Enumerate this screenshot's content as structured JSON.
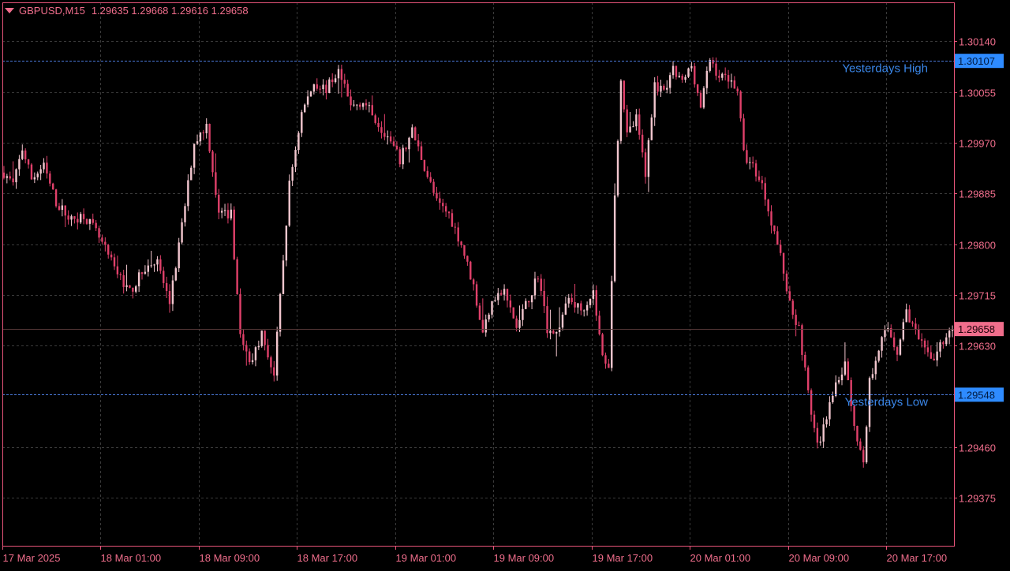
{
  "header": {
    "symbol": "GBPUSD,M15",
    "ohlc": "1.29635 1.29668 1.29616 1.29658"
  },
  "colors": {
    "background": "#000000",
    "frame": "#E8557A",
    "grid": "#3A3A3A",
    "bull": "#F2C6CE",
    "bear": "#E0406A",
    "level_line": "#4A78D8",
    "level_label": "#2E8BFF",
    "level_text": "#3A86E8",
    "price_label": "#F06E8C",
    "axis_text": "#F06E8C"
  },
  "levels": {
    "high": {
      "label": "Yesterdays High",
      "price": 1.30107,
      "price_text": "1.30107"
    },
    "low": {
      "label": "Yesterdays Low",
      "price": 1.29548,
      "price_text": "1.29548"
    },
    "current": {
      "price": 1.29658,
      "price_text": "1.29658"
    }
  },
  "chart_data": {
    "type": "candlestick",
    "title": "GBPUSD,M15",
    "ylim": [
      1.29295,
      1.30205
    ],
    "y_ticks": [
      "1.30140",
      "1.30055",
      "1.29970",
      "1.29885",
      "1.29800",
      "1.29715",
      "1.29630",
      "1.29460",
      "1.29375"
    ],
    "x_ticks": [
      "17 Mar 2025",
      "18 Mar 01:00",
      "18 Mar 09:00",
      "18 Mar 17:00",
      "19 Mar 01:00",
      "19 Mar 09:00",
      "19 Mar 17:00",
      "20 Mar 01:00",
      "20 Mar 09:00",
      "20 Mar 17:00"
    ],
    "trend": [
      [
        0,
        1.2992
      ],
      [
        3,
        1.299
      ],
      [
        6,
        1.2996
      ],
      [
        9,
        1.2991
      ],
      [
        13,
        1.2993
      ],
      [
        17,
        1.2987
      ],
      [
        22,
        1.2984
      ],
      [
        26,
        1.2985
      ],
      [
        30,
        1.2982
      ],
      [
        36,
        1.2976
      ],
      [
        41,
        1.2972
      ],
      [
        46,
        1.2976
      ],
      [
        50,
        1.2977
      ],
      [
        54,
        1.297
      ],
      [
        58,
        1.2983
      ],
      [
        62,
        1.2997
      ],
      [
        66,
        1.3
      ],
      [
        70,
        1.2985
      ],
      [
        74,
        1.2985
      ],
      [
        77,
        1.2965
      ],
      [
        80,
        1.296
      ],
      [
        84,
        1.2965
      ],
      [
        88,
        1.2958
      ],
      [
        90,
        1.2971
      ],
      [
        93,
        1.299
      ],
      [
        97,
        1.3002
      ],
      [
        101,
        1.3007
      ],
      [
        105,
        1.3006
      ],
      [
        109,
        1.3009
      ],
      [
        113,
        1.3003
      ],
      [
        117,
        1.3004
      ],
      [
        121,
        1.3001
      ],
      [
        125,
        1.2998
      ],
      [
        129,
        1.2994
      ],
      [
        133,
        1.2999
      ],
      [
        137,
        1.2993
      ],
      [
        141,
        1.2987
      ],
      [
        145,
        1.2985
      ],
      [
        149,
        1.298
      ],
      [
        153,
        1.2973
      ],
      [
        156,
        1.2965
      ],
      [
        159,
        1.2971
      ],
      [
        163,
        1.2972
      ],
      [
        167,
        1.2966
      ],
      [
        171,
        1.2971
      ],
      [
        174,
        1.2975
      ],
      [
        177,
        1.2966
      ],
      [
        180,
        1.2965
      ],
      [
        184,
        1.2971
      ],
      [
        188,
        1.2969
      ],
      [
        192,
        1.2972
      ],
      [
        195,
        1.2961
      ],
      [
        197,
        1.296
      ],
      [
        199,
        1.2988
      ],
      [
        201,
        1.3008
      ],
      [
        203,
        1.2998
      ],
      [
        206,
        1.3001
      ],
      [
        209,
        1.2992
      ],
      [
        212,
        1.3007
      ],
      [
        215,
        1.3005
      ],
      [
        218,
        1.3009
      ],
      [
        221,
        1.3007
      ],
      [
        224,
        1.301
      ],
      [
        227,
        1.3003
      ],
      [
        230,
        1.3011
      ],
      [
        233,
        1.3008
      ],
      [
        236,
        1.3008
      ],
      [
        239,
        1.3006
      ],
      [
        241,
        1.2995
      ],
      [
        244,
        1.2993
      ],
      [
        247,
        1.299
      ],
      [
        250,
        1.2984
      ],
      [
        253,
        1.2978
      ],
      [
        256,
        1.297
      ],
      [
        259,
        1.2966
      ],
      [
        262,
        1.2955
      ],
      [
        265,
        1.2946
      ],
      [
        268,
        1.2951
      ],
      [
        271,
        1.2956
      ],
      [
        274,
        1.296
      ],
      [
        277,
        1.295
      ],
      [
        280,
        1.2943
      ],
      [
        282,
        1.2957
      ],
      [
        285,
        1.2963
      ],
      [
        288,
        1.2966
      ],
      [
        291,
        1.2962
      ],
      [
        294,
        1.2969
      ],
      [
        297,
        1.2965
      ],
      [
        300,
        1.2962
      ],
      [
        303,
        1.2961
      ],
      [
        306,
        1.2964
      ],
      [
        309,
        1.2966
      ]
    ]
  }
}
